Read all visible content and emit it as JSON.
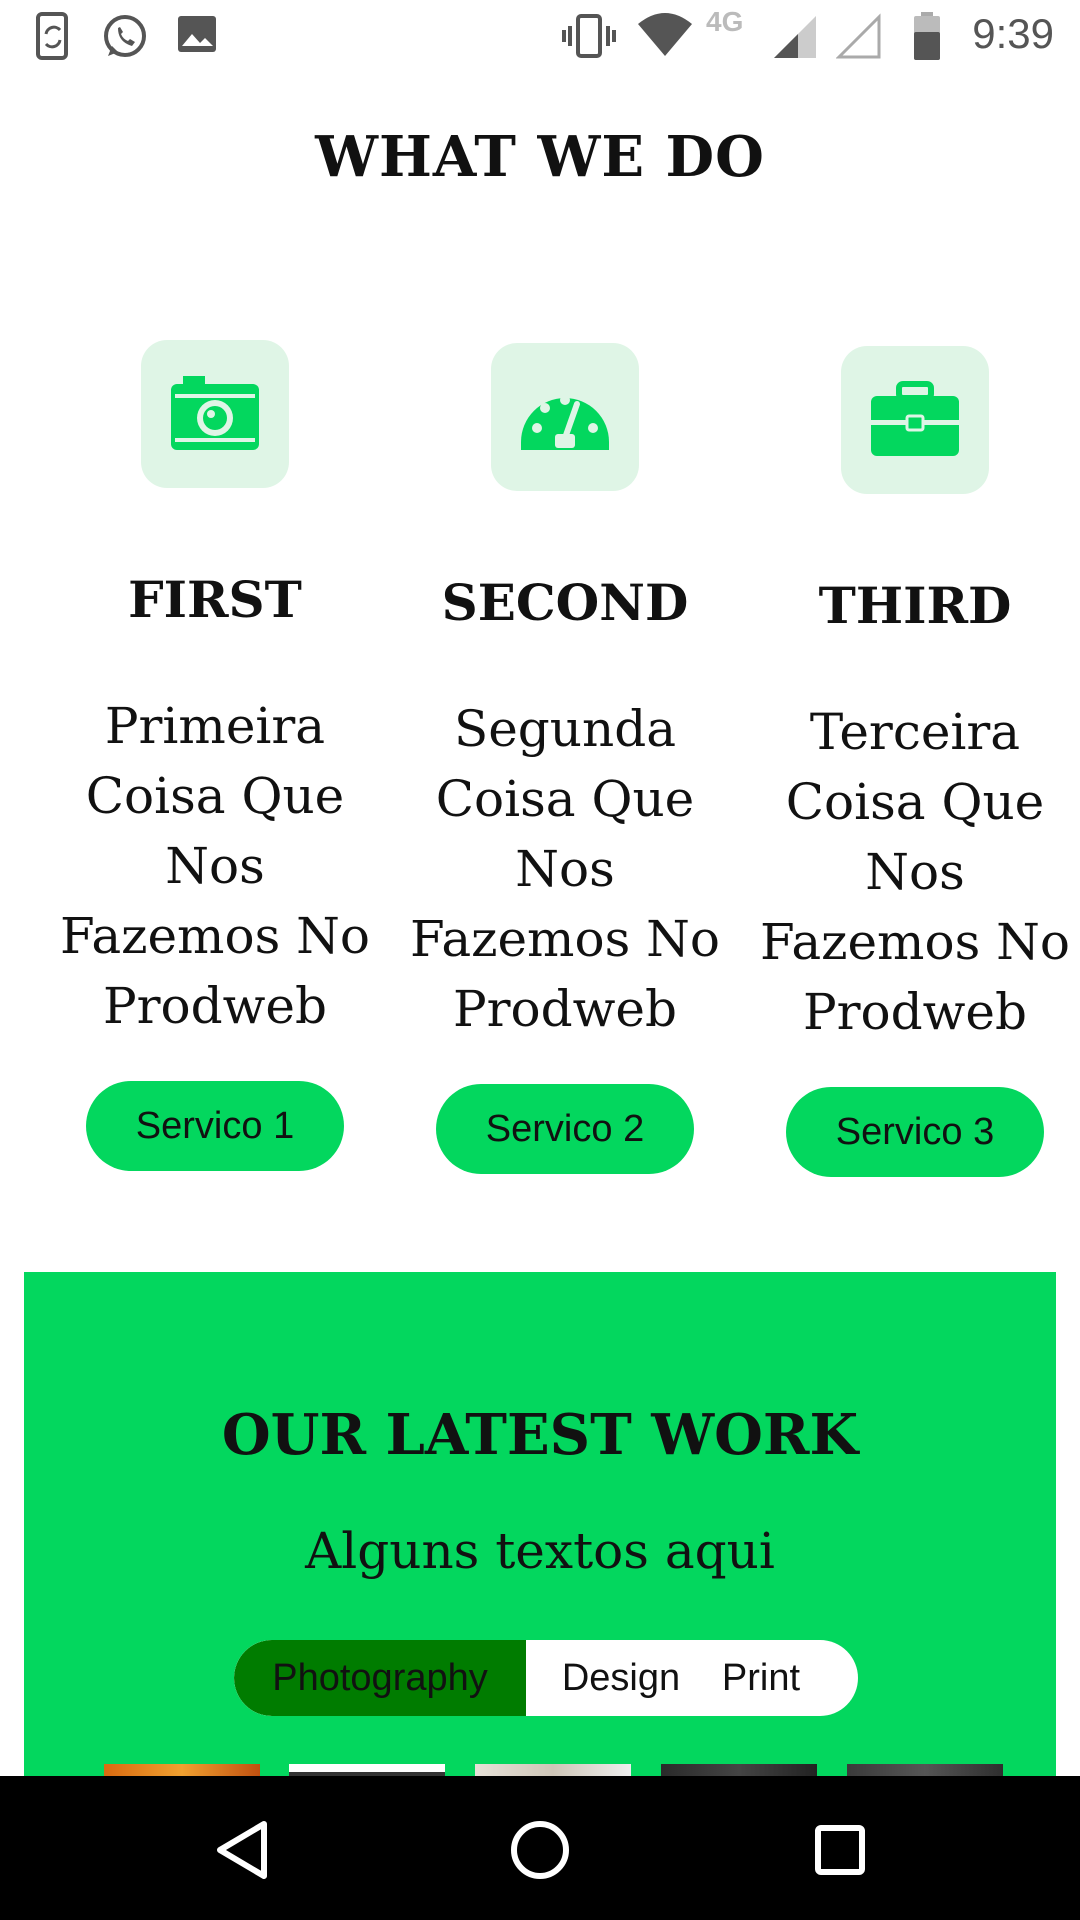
{
  "status_bar": {
    "time": "9:39",
    "network": "4G",
    "icons": [
      "phone-sync-icon",
      "whatsapp-icon",
      "image-icon",
      "vibrate-icon",
      "wifi-icon",
      "signal-icon",
      "signal-empty-icon",
      "battery-icon"
    ]
  },
  "what_we_do": {
    "title": "WHAT WE DO",
    "columns": [
      {
        "icon": "camera-icon",
        "heading": "FIRST",
        "description": "Primeira Coisa Que Nos Fazemos No Prodweb",
        "button": "Servico 1"
      },
      {
        "icon": "speedometer-icon",
        "heading": "SECOND",
        "description": "Segunda Coisa Que Nos Fazemos No Prodweb",
        "button": "Servico 2"
      },
      {
        "icon": "briefcase-icon",
        "heading": "THIRD",
        "description": "Terceira Coisa Que Nos Fazemos No Prodweb",
        "button": "Servico 3"
      }
    ]
  },
  "latest_work": {
    "title": "OUR LATEST WORK",
    "subtitle": "Alguns textos aqui",
    "filters": [
      "Photography",
      "Design",
      "Print"
    ],
    "active_filter": "Photography"
  },
  "navigation": {
    "buttons": [
      "back-icon",
      "home-icon",
      "recents-icon"
    ]
  },
  "colors": {
    "accent": "#03d75e",
    "active_filter": "#007c00",
    "icon_bg": "#dff5e6"
  }
}
